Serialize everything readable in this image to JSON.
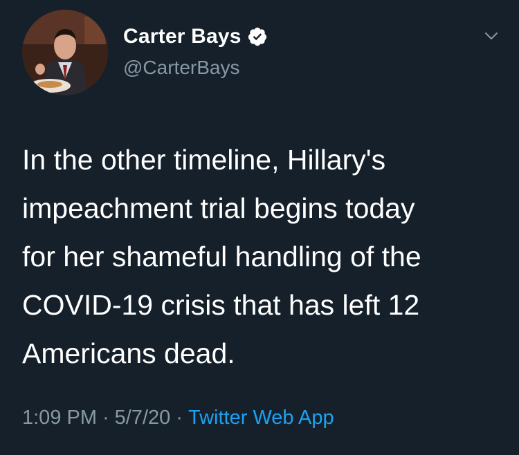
{
  "tweet": {
    "author": {
      "display_name": "Carter Bays",
      "handle": "@CarterBays",
      "verified": true
    },
    "text": "In the other timeline, Hillary's\nimpeachment trial begins today\nfor her shameful handling of the\nCOVID-19 crisis that has left 12\nAmericans dead.",
    "time": "1:09 PM",
    "separator": "·",
    "date": "5/7/20",
    "source": "Twitter Web App"
  },
  "colors": {
    "background": "#15202b",
    "text_primary": "#ffffff",
    "text_secondary": "#8899a6",
    "link": "#1da1f2"
  },
  "icons": {
    "verified": "verified-badge-icon",
    "more": "chevron-down-icon"
  }
}
